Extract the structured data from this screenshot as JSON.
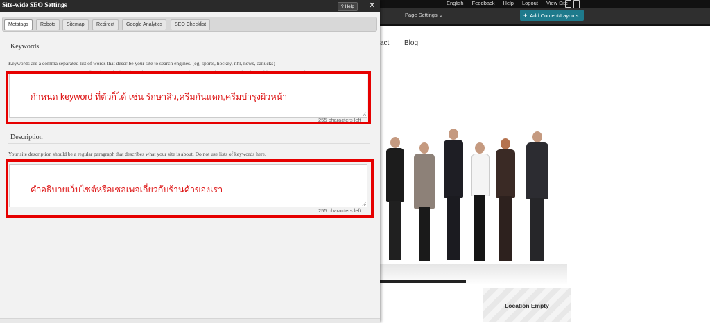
{
  "top_bar": {
    "language": "English",
    "feedback": "Feedback",
    "help": "Help",
    "logout": "Logout",
    "view_site": "View Site"
  },
  "editor_toolbar": {
    "page_settings": "Page Settings",
    "add_content": "Add Content/Layouts",
    "accent_color": "#1e7a8c"
  },
  "site": {
    "nav_items": [
      "act",
      "Blog"
    ],
    "location_empty": "Location Empty"
  },
  "modal": {
    "title": "Site-wide SEO Settings",
    "help_button": "Help",
    "close_label": "✕",
    "tabs": [
      {
        "label": "Metatags",
        "active": true
      },
      {
        "label": "Robots"
      },
      {
        "label": "Sitemap"
      },
      {
        "label": "Redirect"
      },
      {
        "label": "Google Analytics"
      },
      {
        "label": "SEO Checklist"
      }
    ],
    "keywords": {
      "title": "Keywords",
      "help": "Keywords are a comma separated list of words that describe your site to search engines. (eg. sports, hockey, nhl, news, canucks)",
      "value": "กำหนด keyword ที่ตัวก็ได้ เช่น   รักษาสิว,ครีมกันแดก,ครีมบำรุงผิวหน้า",
      "counter": "255 characters left"
    },
    "description": {
      "title": "Description",
      "help": "Your site description should be a regular paragraph that describes what your site is about. Do not use lists of keywords here.",
      "value": "คำอธิบายเว็บไซต์หรือเซลเพจเกี่ยวกับร้านค้าของเรา",
      "counter": "255 characters left"
    }
  },
  "highlight_color": "#e60000"
}
